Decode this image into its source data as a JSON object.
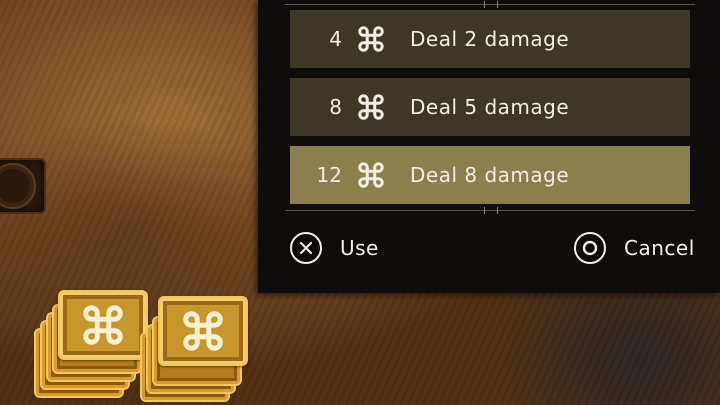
{
  "menu": {
    "rows": [
      {
        "cost": "4",
        "effect": "Deal 2 damage",
        "selected": false
      },
      {
        "cost": "8",
        "effect": "Deal 5 damage",
        "selected": false
      },
      {
        "cost": "12",
        "effect": "Deal 8 damage",
        "selected": true
      }
    ]
  },
  "footer": {
    "use_label": "Use",
    "cancel_label": "Cancel"
  },
  "icons": {
    "resource": "command-key-icon",
    "use_button": "cross-button-icon",
    "cancel_button": "circle-button-icon"
  },
  "colors": {
    "row_normal": "#3f3726",
    "row_selected": "#8b7f4b",
    "token_gold": "#c9962c"
  }
}
